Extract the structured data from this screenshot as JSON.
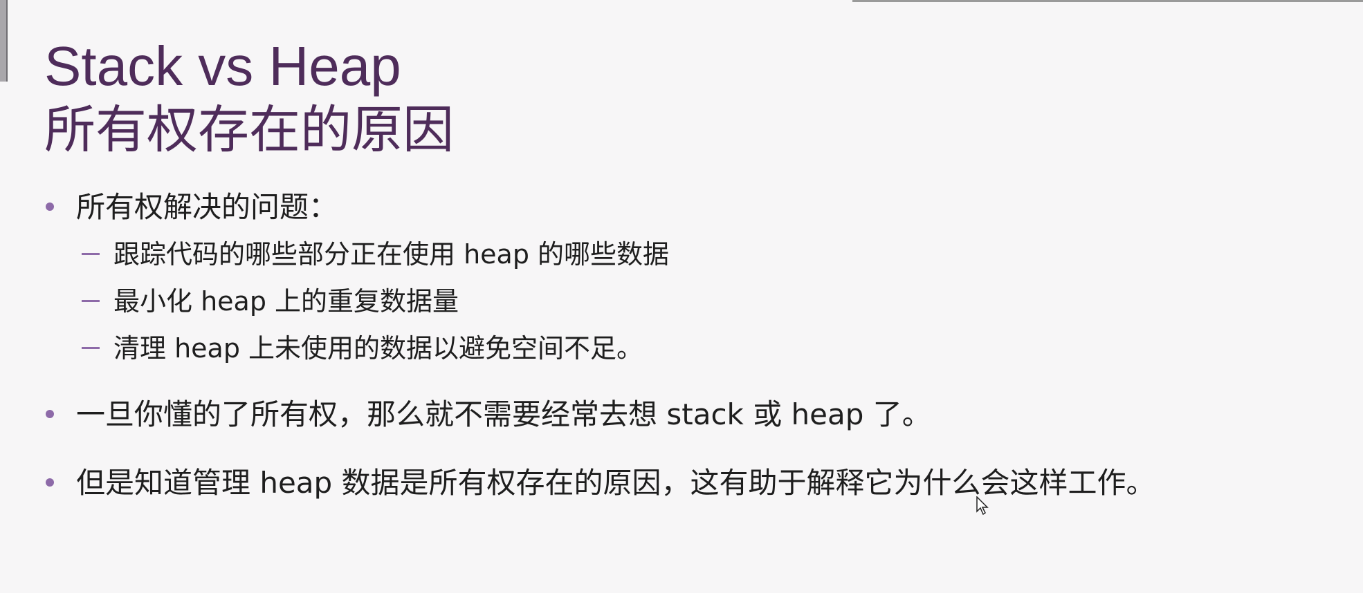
{
  "slide": {
    "title_line1": "Stack vs Heap",
    "title_line2": "所有权存在的原因",
    "bullets": [
      {
        "text": "所有权解决的问题：",
        "subs": [
          "跟踪代码的哪些部分正在使用 heap 的哪些数据",
          "最小化 heap 上的重复数据量",
          "清理 heap 上未使用的数据以避免空间不足。"
        ]
      },
      {
        "text": "一旦你懂的了所有权，那么就不需要经常去想 stack 或 heap 了。"
      },
      {
        "text": "但是知道管理 heap 数据是所有权存在的原因，这有助于解释它为什么会这样工作。"
      }
    ]
  },
  "colors": {
    "title": "#4e2c5a",
    "bullet_marker": "#8d6aa8",
    "body_text": "#1e1e1e",
    "background": "#f7f6f7"
  },
  "icons": {
    "pointer": "mouse-cursor-icon"
  }
}
